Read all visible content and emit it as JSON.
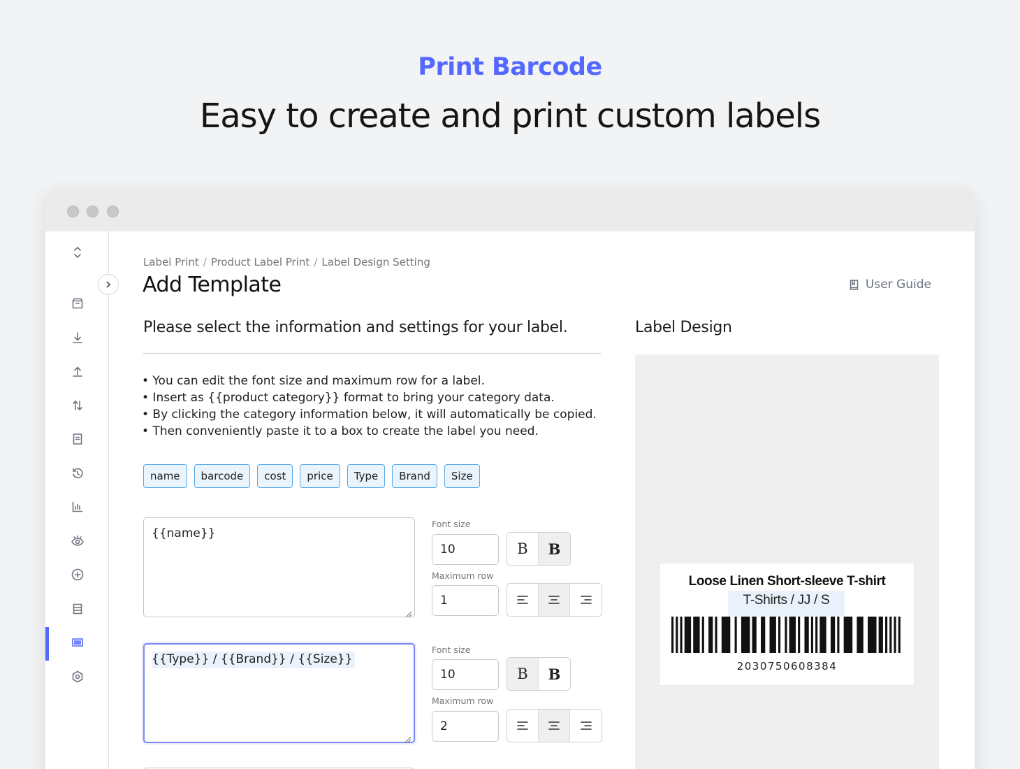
{
  "hero": {
    "kicker": "Print Barcode",
    "title": "Easy to create and print custom labels"
  },
  "colors": {
    "accent": "#5468ff",
    "chip_border": "#58a8e6",
    "chip_bg": "#eaf4fd",
    "design_bg": "#efefef"
  },
  "sidebar": {
    "icons": [
      "switch-icon",
      "archive-box-icon",
      "download-icon",
      "upload-icon",
      "transfer-icon",
      "document-icon",
      "history-icon",
      "bar-chart-icon",
      "eye-icon",
      "plus-circle-icon",
      "database-icon",
      "barcode-icon",
      "settings-icon"
    ],
    "active": "barcode-icon"
  },
  "breadcrumb": [
    "Label Print",
    "Product Label Print",
    "Label Design Setting"
  ],
  "page": {
    "title": "Add Template",
    "user_guide": "User Guide"
  },
  "form": {
    "heading": "Please select the information and settings for your label.",
    "tips": [
      "• You can edit the font size and maximum row for a label.",
      "• Insert as {{product category}} format to bring your category data.",
      "• By clicking the category information below, it will automatically be copied.",
      "• Then conveniently paste it to a box to create the label you need."
    ],
    "chips": [
      "name",
      "barcode",
      "cost",
      "price",
      "Type",
      "Brand",
      "Size"
    ],
    "fields": [
      {
        "text": "{{name}}",
        "font_size_label": "Font size",
        "font_size": "10",
        "max_row_label": "Maximum row",
        "max_row": "1",
        "bold_selected": "bold",
        "align_selected": "center"
      },
      {
        "text": "{{Type}} / {{Brand}} / {{Size}}",
        "font_size_label": "Font size",
        "font_size": "10",
        "max_row_label": "Maximum row",
        "max_row": "2",
        "bold_selected": "regular",
        "align_selected": "center"
      }
    ],
    "bold_regular_glyph": "B",
    "bold_bold_glyph": "B"
  },
  "design": {
    "heading": "Label Design",
    "label": {
      "name": "Loose Linen Short-sleeve T-shirt",
      "sub": "T-Shirts / JJ / S",
      "barcode_number": "2030750608384"
    }
  }
}
